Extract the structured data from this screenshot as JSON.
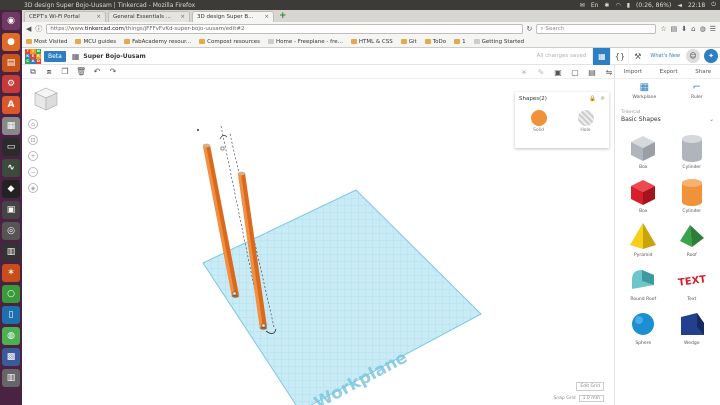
{
  "os": {
    "window_title": "3D design Super Bojo-Uusam | Tinkercad - Mozilla Firefox",
    "tray": {
      "battery": "(0:26, 86%)",
      "time": "22:18"
    }
  },
  "browser": {
    "tabs": [
      {
        "label": "CEPT's Wi-Fi Portal"
      },
      {
        "label": "General Essentials ..."
      },
      {
        "label": "3D design Super B..."
      }
    ],
    "url": {
      "prefix": "https://www.",
      "host": "tinkercad.com",
      "path": "/things/jFFFvFvKd-super-bojo-uusam/edit#2"
    },
    "search_placeholder": "Search",
    "bookmarks": [
      {
        "label": "Most Visited"
      },
      {
        "label": "MCU guides"
      },
      {
        "label": "FabAcademy resour..."
      },
      {
        "label": "Compost resources"
      },
      {
        "label": "Home - Freeplane - fre..."
      },
      {
        "label": "HTML & CSS"
      },
      {
        "label": "Git"
      },
      {
        "label": "ToDo"
      },
      {
        "label": "1"
      },
      {
        "label": "Getting Started"
      }
    ]
  },
  "app": {
    "logo_letters": [
      "T",
      "I",
      "N",
      "K",
      "E",
      "R",
      "C",
      "A",
      "D"
    ],
    "logo_colors": [
      "#e8412f",
      "#f29a1d",
      "#2db14a",
      "#2e7fc1",
      "#e8412f",
      "#f29a1d",
      "#2db14a",
      "#2e7fc1",
      "#e8412f"
    ],
    "beta_label": "Beta",
    "design_name": "Super Bojo-Uusam",
    "saved_status": "All changes saved",
    "whats_new": "What's New",
    "inspector": {
      "title": "Shapes(2)",
      "solid_label": "Solid",
      "hole_label": "Hole"
    },
    "library": {
      "tabs": [
        "Import",
        "Export",
        "Share"
      ],
      "tools": [
        {
          "label": "Workplane"
        },
        {
          "label": "Ruler"
        }
      ],
      "section": "Tinkercad",
      "category": "Basic Shapes",
      "shapes": [
        {
          "label": "Box",
          "color": "#b0b4bb"
        },
        {
          "label": "Cylinder",
          "color": "#b0b4bb"
        },
        {
          "label": "Box",
          "color": "#d61f2b"
        },
        {
          "label": "Cylinder",
          "color": "#f0923a"
        },
        {
          "label": "Pyramid",
          "color": "#f6cf1a"
        },
        {
          "label": "Roof",
          "color": "#3aa24a"
        },
        {
          "label": "Round Roof",
          "color": "#6cc6c9"
        },
        {
          "label": "Text",
          "color": "#d61f2b"
        },
        {
          "label": "Sphere",
          "color": "#1c8fd2"
        },
        {
          "label": "Wedge",
          "color": "#23408e"
        }
      ],
      "text_shape_word": "TEXT"
    },
    "viewport": {
      "workplane_label": "Workplane",
      "edit_grid": "Edit Grid",
      "snap_label": "Snap Grid",
      "snap_value": "1.0 mm"
    }
  }
}
